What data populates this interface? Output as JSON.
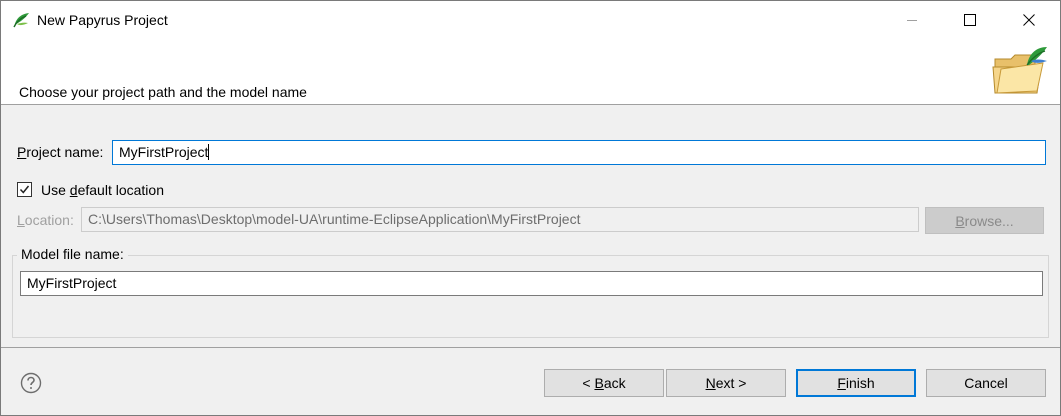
{
  "window": {
    "title": "New Papyrus Project",
    "app_icon": "papyrus-leaf-icon",
    "controls": [
      "minimize-icon",
      "maximize-icon",
      "close-icon"
    ]
  },
  "banner": {
    "message": "Choose your project path and the model name",
    "icon": "open-folder-icon"
  },
  "form": {
    "project_name_prefix": "P",
    "project_name_rest": "roject name:",
    "project_name_value": "MyFirstProject",
    "use_default_pre": "Use ",
    "use_default_mnemonic": "d",
    "use_default_post": "efault location",
    "use_default_checked": true,
    "location_mnemonic": "L",
    "location_rest": "ocation:",
    "location_value": "C:\\Users\\Thomas\\Desktop\\model-UA\\runtime-EclipseApplication\\MyFirstProject",
    "browse_mnemonic": "B",
    "browse_rest": "rowse...",
    "model_group_title": "Model file name:",
    "model_file_value": "MyFirstProject"
  },
  "buttons": {
    "back_pre": "< ",
    "back_mnemonic": "B",
    "back_post": "ack",
    "next_mnemonic": "N",
    "next_post": "ext >",
    "finish_mnemonic": "F",
    "finish_post": "inish",
    "cancel": "Cancel"
  },
  "colors": {
    "accent": "#0078d7",
    "dialog_bg": "#f0f0f0",
    "papyrus_green": "#2e9a3a"
  }
}
